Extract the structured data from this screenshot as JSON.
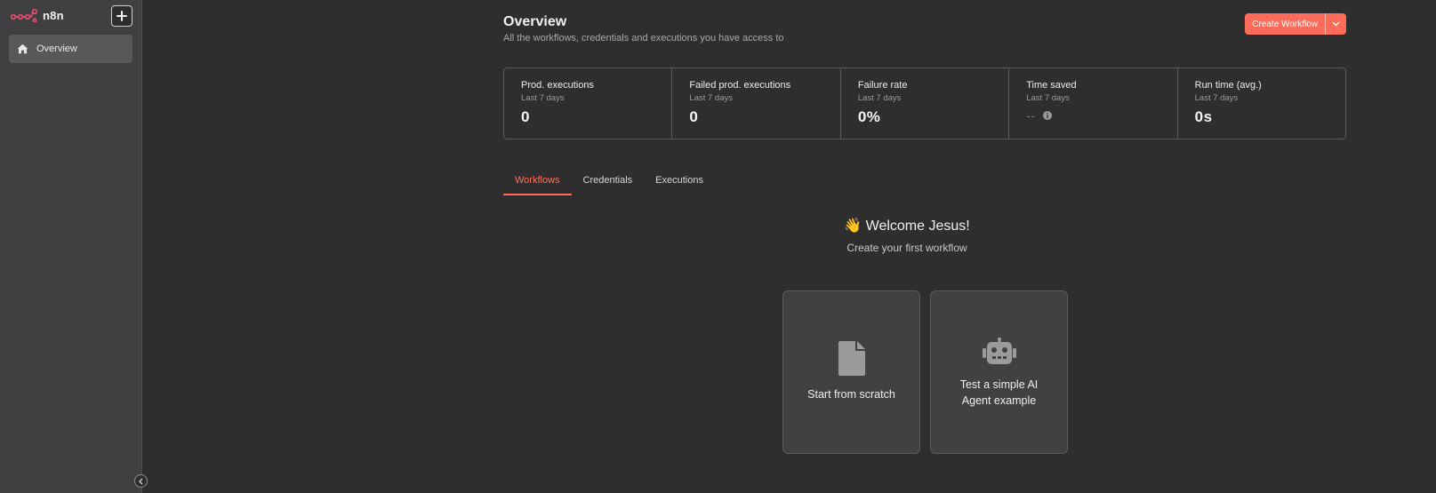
{
  "app": {
    "name": "n8n",
    "brand_color": "#ea4b71",
    "accent_color": "#ff6d5a"
  },
  "sidebar": {
    "items": [
      {
        "label": "Overview",
        "icon": "home-icon",
        "active": true
      }
    ]
  },
  "header": {
    "title": "Overview",
    "subtitle": "All the workflows, credentials and executions you have access to",
    "create_label": "Create Workflow"
  },
  "stats": [
    {
      "label": "Prod. executions",
      "period": "Last 7 days",
      "value": "0"
    },
    {
      "label": "Failed prod. executions",
      "period": "Last 7 days",
      "value": "0"
    },
    {
      "label": "Failure rate",
      "period": "Last 7 days",
      "value": "0%"
    },
    {
      "label": "Time saved",
      "period": "Last 7 days",
      "value": "--"
    },
    {
      "label": "Run time (avg.)",
      "period": "Last 7 days",
      "value": "0s"
    }
  ],
  "tabs": [
    {
      "label": "Workflows",
      "active": true
    },
    {
      "label": "Credentials",
      "active": false
    },
    {
      "label": "Executions",
      "active": false
    }
  ],
  "welcome": {
    "title": "👋 Welcome Jesus!",
    "subtitle": "Create your first workflow"
  },
  "cards": [
    {
      "label": "Start from scratch",
      "icon": "file-icon"
    },
    {
      "label": "Test a simple AI Agent example",
      "icon": "robot-icon"
    }
  ]
}
